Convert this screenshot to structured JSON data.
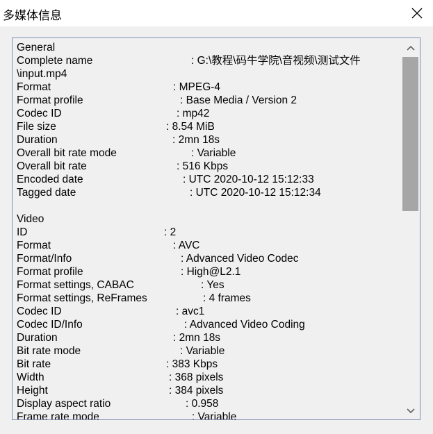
{
  "window": {
    "title": "多媒体信息"
  },
  "icons": {
    "close": "close-icon",
    "up": "chevron-up-icon",
    "down": "chevron-down-icon"
  },
  "lines": [
    {
      "key": "General",
      "value": ""
    },
    {
      "key": "Complete name",
      "value": ": G:\\教程\\码牛学院\\音视频\\测试文件"
    },
    {
      "key": "\\input.mp4",
      "value": ""
    },
    {
      "key": "Format",
      "value": ": MPEG-4"
    },
    {
      "key": "Format profile",
      "value": ": Base Media / Version 2"
    },
    {
      "key": "Codec ID",
      "value": ": mp42"
    },
    {
      "key": "File size",
      "value": ": 8.54 MiB"
    },
    {
      "key": "Duration",
      "value": ": 2mn 18s"
    },
    {
      "key": "Overall bit rate mode",
      "value": ": Variable"
    },
    {
      "key": "Overall bit rate",
      "value": ": 516 Kbps"
    },
    {
      "key": "Encoded date",
      "value": ": UTC 2020-10-12 15:12:33"
    },
    {
      "key": "Tagged date",
      "value": ": UTC 2020-10-12 15:12:34"
    },
    {
      "key": "",
      "value": ""
    },
    {
      "key": "Video",
      "value": ""
    },
    {
      "key": "ID",
      "value": ": 2"
    },
    {
      "key": "Format",
      "value": ": AVC"
    },
    {
      "key": "Format/Info",
      "value": ": Advanced Video Codec"
    },
    {
      "key": "Format profile",
      "value": ": High@L2.1"
    },
    {
      "key": "Format settings, CABAC",
      "value": ": Yes"
    },
    {
      "key": "Format settings, ReFrames",
      "value": ": 4 frames"
    },
    {
      "key": "Codec ID",
      "value": ": avc1"
    },
    {
      "key": "Codec ID/Info",
      "value": ": Advanced Video Coding"
    },
    {
      "key": "Duration",
      "value": ": 2mn 18s"
    },
    {
      "key": "Bit rate mode",
      "value": ": Variable"
    },
    {
      "key": "Bit rate",
      "value": ": 383 Kbps"
    },
    {
      "key": "Width",
      "value": ": 368 pixels"
    },
    {
      "key": "Height",
      "value": ": 384 pixels"
    },
    {
      "key": "Display aspect ratio",
      "value": ": 0.958"
    },
    {
      "key": "Frame rate mode",
      "value": ": Variable"
    }
  ]
}
